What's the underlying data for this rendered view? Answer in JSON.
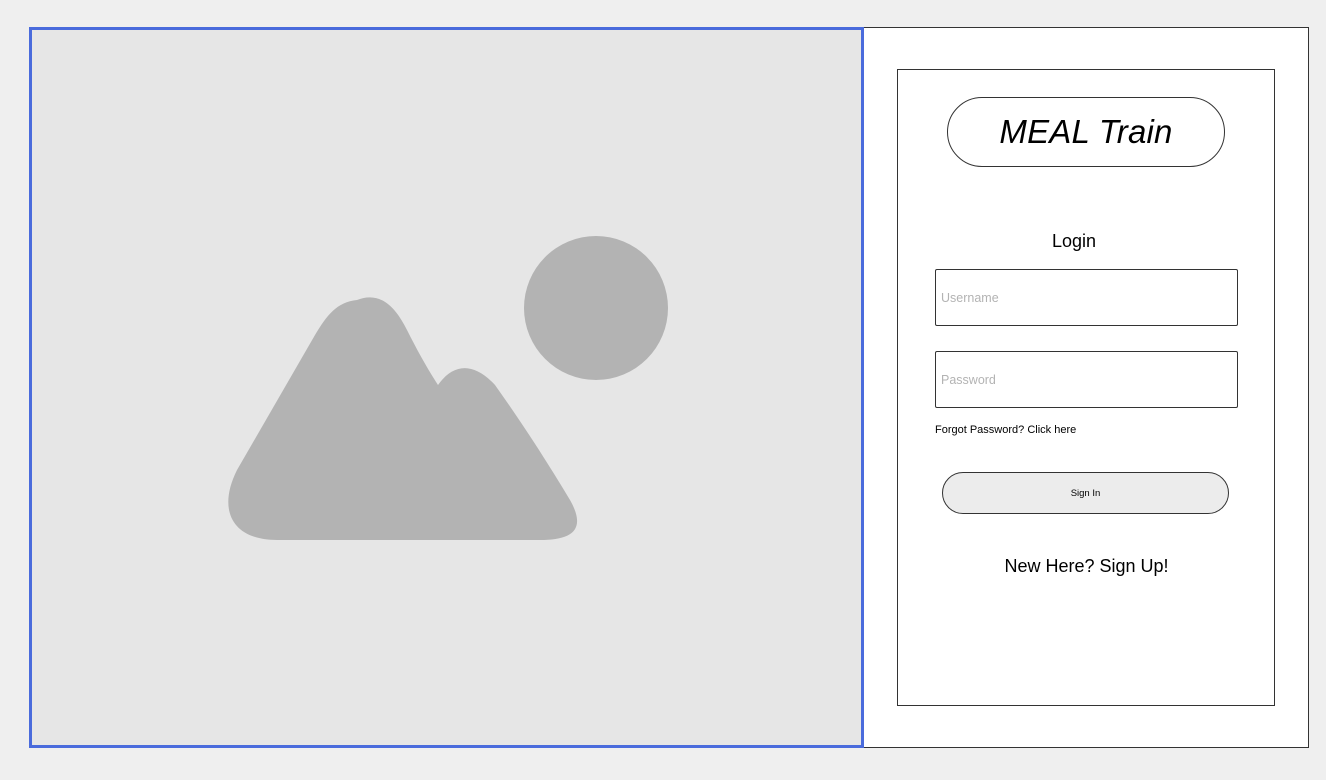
{
  "colors": {
    "page_background": "#efefef",
    "image_placeholder_background": "#e6e6e6",
    "image_selection_border": "#4a6bdc",
    "placeholder_icon": "#b3b3b3",
    "signin_button_background": "#ececec"
  },
  "hero_image": {
    "icon": "image-placeholder-icon"
  },
  "login": {
    "logo_text": "MEAL Train",
    "heading": "Login",
    "username_placeholder": "Username",
    "password_placeholder": "Password",
    "forgot_password": "Forgot Password? Click here",
    "signin_label": "Sign In",
    "signup_link": "New Here? Sign Up!"
  }
}
